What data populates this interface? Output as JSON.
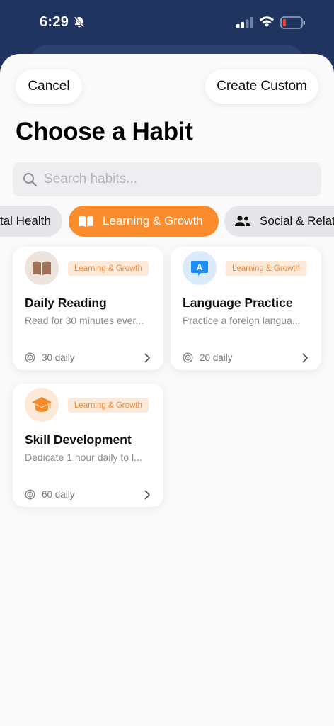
{
  "status_bar": {
    "time": "6:29"
  },
  "header": {
    "cancel_label": "Cancel",
    "create_label": "Create Custom",
    "title": "Choose a Habit"
  },
  "search": {
    "placeholder": "Search habits..."
  },
  "categories": [
    {
      "label": "tal Health",
      "icon": "none",
      "selected": false
    },
    {
      "label": "Learning & Growth",
      "icon": "book-icon",
      "selected": true
    },
    {
      "label": "Social & Relati",
      "icon": "people-icon",
      "selected": false
    }
  ],
  "habits": [
    {
      "title": "Daily Reading",
      "description": "Read for 30 minutes ever...",
      "badge": "Learning & Growth",
      "target": "30 daily",
      "icon": "book-icon",
      "icon_bg": "#ede4de",
      "icon_color": "#a07358"
    },
    {
      "title": "Language Practice",
      "description": "Practice a foreign langua...",
      "badge": "Learning & Growth",
      "target": "20 daily",
      "icon": "translate-bubble-icon",
      "icon_bg": "#dcebfb",
      "icon_color": "#1e8ef5"
    },
    {
      "title": "Skill Development",
      "description": "Dedicate 1 hour daily to l...",
      "badge": "Learning & Growth",
      "target": "60 daily",
      "icon": "graduation-cap-icon",
      "icon_bg": "#fde9d8",
      "icon_color": "#f58a2a"
    }
  ],
  "colors": {
    "accent": "#fb8c2e",
    "header_bg": "#1f3560",
    "badge_bg": "#fde9d8",
    "badge_text": "#f08a3c"
  }
}
